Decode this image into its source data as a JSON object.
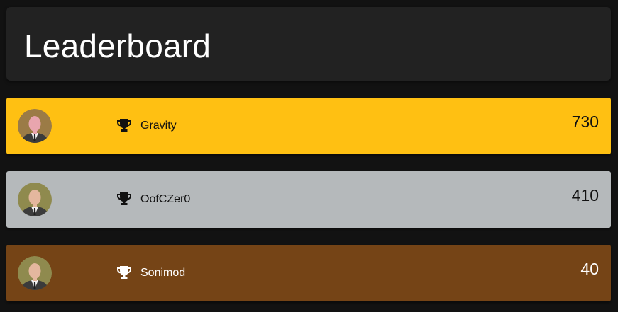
{
  "header": {
    "title": "Leaderboard"
  },
  "colors": {
    "background": "#121212",
    "header_bg": "#222222",
    "gold": "#FFC012",
    "silver": "#B5B9BB",
    "bronze": "#754416"
  },
  "entries": [
    {
      "name": "Gravity",
      "score": "730",
      "icon": "trophy-icon",
      "avatar": "avatar",
      "row_color": "#FFC012",
      "text_color": "#111111"
    },
    {
      "name": "OofCZer0",
      "score": "410",
      "icon": "trophy-icon",
      "avatar": "avatar",
      "row_color": "#B5B9BB",
      "text_color": "#111111"
    },
    {
      "name": "Sonimod",
      "score": "40",
      "icon": "trophy-icon",
      "avatar": "avatar",
      "row_color": "#754416",
      "text_color": "#ffffff"
    }
  ]
}
